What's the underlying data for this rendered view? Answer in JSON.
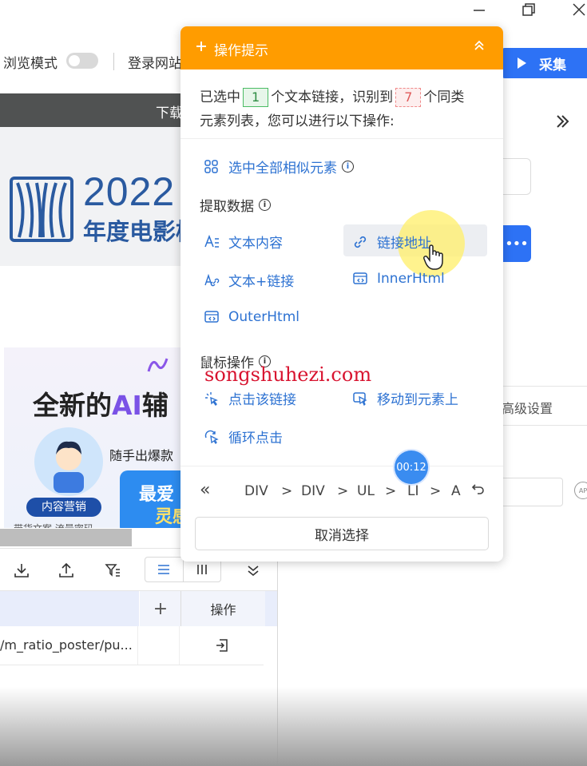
{
  "window": {
    "minimize_icon": "minimize-icon",
    "maximize_icon": "maximize-icon",
    "close_icon": "close-icon"
  },
  "toolbar": {
    "browse_mode_label": "浏览模式",
    "login_label": "登录网站"
  },
  "page": {
    "download_bar_text": "下载",
    "banner": {
      "year": "2022",
      "subtitle": "年度电影榜"
    },
    "ad": {
      "title_prefix": "全新的",
      "title_ai": "AI",
      "title_suffix": "辅",
      "subtitle": "随手出爆款",
      "card_line1": "最爱",
      "card_line2": "灵感",
      "tag": "内容营销",
      "footer": "带货文案 流量密码"
    }
  },
  "table": {
    "add_column": "+",
    "op_header": "操作",
    "rows": [
      {
        "value": "/m_ratio_poster/pu..."
      }
    ]
  },
  "right_panel": {
    "collect_label": "采集",
    "more_label": "•••",
    "advanced_settings": "高级设置",
    "ap_label": "AP"
  },
  "popup": {
    "title": "操作提示",
    "selected_prefix": "已选中",
    "selected_count": "1",
    "selected_mid": "个文本链接，识别到",
    "similar_count": "7",
    "selected_suffix": "个同类",
    "line2": "元素列表，您可以进行以下操作:",
    "select_all": "选中全部相似元素",
    "extract_section": "提取数据",
    "text_content": "文本内容",
    "link_address": "链接地址",
    "text_link": "文本+链接",
    "inner_html": "InnerHtml",
    "outer_html": "OuterHtml",
    "mouse_section": "鼠标操作",
    "click_link": "点击该链接",
    "move_to_element": "移动到元素上",
    "loop_click": "循环点击",
    "watermark": "songshuhezi.com",
    "timer": "00:12",
    "breadcrumb": {
      "first": "«",
      "items": [
        "DIV",
        "DIV",
        "UL",
        "LI",
        "A"
      ],
      "separator": ">"
    },
    "cancel": "取消选择"
  }
}
